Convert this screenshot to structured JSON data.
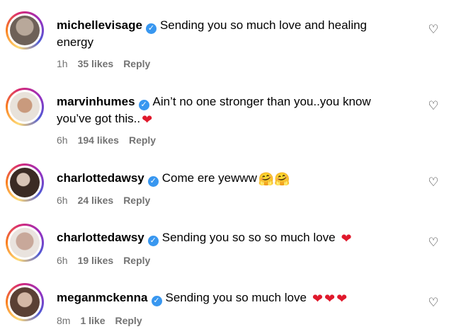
{
  "comments": [
    {
      "username": "michellevisage",
      "text_line1": "Sending you so much love and healing",
      "text_line2": "energy",
      "time": "1h",
      "likes": "35 likes",
      "reply": "Reply",
      "emoji": ""
    },
    {
      "username": "marvinhumes",
      "text_line1": "Ain’t no one stronger than you..you know",
      "text_line2": "you’ve got this..",
      "time": "6h",
      "likes": "194 likes",
      "reply": "Reply",
      "emoji": "❤"
    },
    {
      "username": "charlottedawsy",
      "text_line1": "Come ere yewww",
      "time": "6h",
      "likes": "24 likes",
      "reply": "Reply",
      "emoji": "🤗🤗"
    },
    {
      "username": "charlottedawsy",
      "text_line1": "Sending you so so so much love",
      "time": "6h",
      "likes": "19 likes",
      "reply": "Reply",
      "emoji": "❤"
    },
    {
      "username": "meganmckenna",
      "text_line1": "Sending you so much love",
      "time": "8m",
      "likes": "1 like",
      "reply": "Reply",
      "emoji": "❤❤❤"
    }
  ],
  "icons": {
    "verified": "verified-badge-icon",
    "like": "heart-outline-icon"
  },
  "colors": {
    "verified_blue": "#3897f0",
    "heart_red": "#e0192c",
    "meta_gray": "#737373"
  }
}
